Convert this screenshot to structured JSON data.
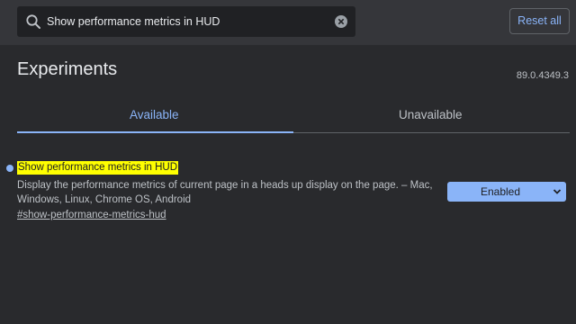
{
  "search": {
    "value": "Show performance metrics in HUD",
    "icon": "search-icon",
    "clear_icon": "close-circle-icon"
  },
  "header": {
    "reset_label": "Reset all"
  },
  "main": {
    "title": "Experiments",
    "version": "89.0.4349.3",
    "tabs": [
      {
        "label": "Available",
        "active": true
      },
      {
        "label": "Unavailable",
        "active": false
      }
    ]
  },
  "experiment": {
    "name": "Show performance metrics in HUD",
    "description": "Display the performance metrics of current page in a heads up display on the page. – Mac, Windows, Linux, Chrome OS, Android",
    "link": "#show-performance-metrics-hud",
    "selected_option": "Enabled"
  },
  "colors": {
    "background": "#292a2d",
    "header": "#35363a",
    "accent": "#8ab4f8",
    "highlight": "#ffff00"
  }
}
